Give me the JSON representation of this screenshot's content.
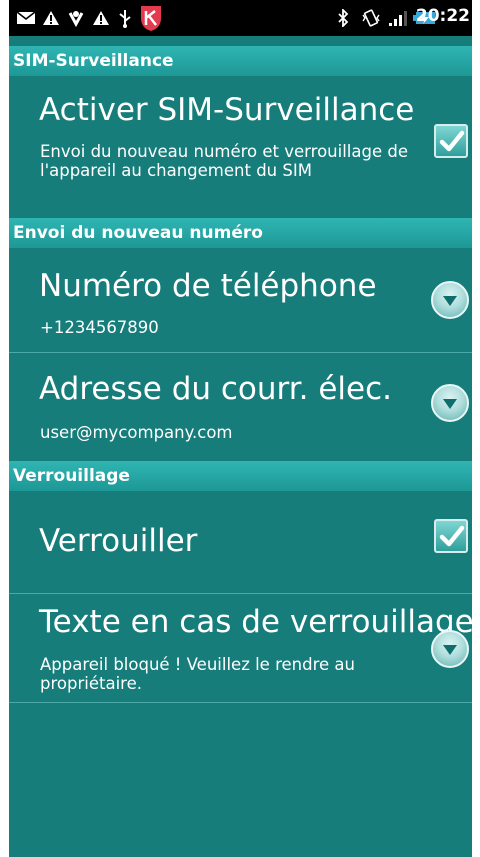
{
  "status_bar": {
    "time": "20:22",
    "icons": [
      "mail-icon",
      "warning-icon",
      "sync-icon",
      "warning-icon",
      "usb-icon",
      "kaspersky-icon",
      "bluetooth-icon",
      "vibrate-icon",
      "signal-icon",
      "battery-charging-icon"
    ]
  },
  "sections": {
    "sim": "SIM-Surveillance",
    "send": "Envoi du nouveau numéro",
    "lock": "Verrouillage"
  },
  "items": {
    "activate": {
      "title": "Activer SIM-Surveillance",
      "summary": "Envoi du nouveau numéro et verrouillage de l'appareil au changement du SIM",
      "checked": true
    },
    "phone": {
      "title": "Numéro de téléphone",
      "summary": "+1234567890"
    },
    "email": {
      "title": "Adresse du courr. élec.",
      "summary": "user@mycompany.com"
    },
    "lock": {
      "title": "Verrouiller",
      "checked": true
    },
    "lock_text": {
      "title": "Texte en cas de verrouillage",
      "summary": "Appareil bloqué ! Veuillez le rendre au propriétaire."
    }
  },
  "colors": {
    "background": "#167d7b",
    "section_header": "#2fb5b3",
    "status_bar": "#000000"
  }
}
